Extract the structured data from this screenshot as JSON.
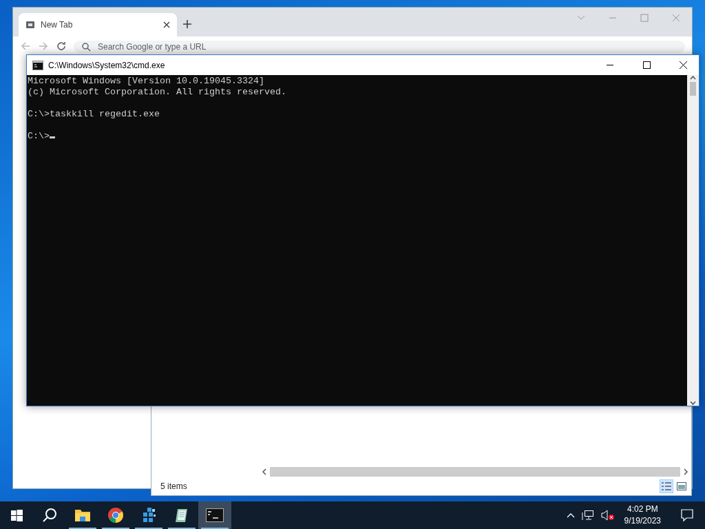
{
  "browser": {
    "tab_title": "New Tab",
    "address_placeholder": "Search Google or type a URL"
  },
  "explorer": {
    "status": "5 items",
    "view_buttons": [
      {
        "kind": "details",
        "selected": true
      },
      {
        "kind": "preview",
        "selected": false
      }
    ]
  },
  "console": {
    "title": "C:\\Windows\\System32\\cmd.exe",
    "blocks": [
      [
        "Microsoft Windows [Version 10.0.19045.3324]",
        "(c) Microsoft Corporation. All rights reserved."
      ],
      [
        "C:\\>taskkill regedit.exe"
      ],
      [
        "C:\\>"
      ]
    ],
    "cursor": true
  },
  "taskbar": {
    "apps": [
      {
        "kind": "folder",
        "running": true,
        "selected": false
      },
      {
        "kind": "browser",
        "running": true,
        "selected": false
      },
      {
        "kind": "registry",
        "running": true,
        "selected": false
      },
      {
        "kind": "notepad",
        "running": true,
        "selected": false
      },
      {
        "kind": "console",
        "running": true,
        "selected": true
      }
    ],
    "clock": {
      "time": "4:02 PM",
      "date": "9/19/2023"
    },
    "sound_muted": true
  }
}
